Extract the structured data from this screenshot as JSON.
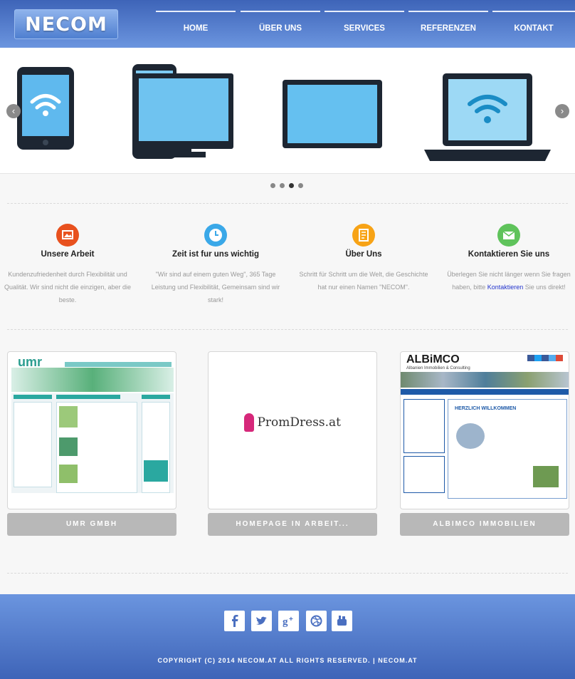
{
  "brand": {
    "logo_text": "NECOM"
  },
  "nav": [
    "HOME",
    "ÜBER UNS",
    "SERVICES",
    "REFERENZEN",
    "KONTAKT"
  ],
  "slider": {
    "prev_label": "‹",
    "next_label": "›",
    "dots": 4,
    "active_dot": 3,
    "icons": [
      "tablet-icon",
      "monitor-icon",
      "display-icon",
      "laptop-icon"
    ]
  },
  "features": [
    {
      "title": "Unsere Arbeit",
      "text": "Kundenzufriedenheit durch Flexibilität und Qualität. Wir sind nicht die einzigen, aber die beste.",
      "color": "#e8511e",
      "icon": "picture-icon"
    },
    {
      "title": "Zeit ist fur uns wichtig",
      "text": "\"Wir sind auf einem guten Weg\", 365 Tage Leistung und Flexibilität, Gemeinsam sind wir stark!",
      "color": "#3aa8e8",
      "icon": "clock-icon"
    },
    {
      "title": "Über Uns",
      "text": "Schritt für Schritt um die Welt, die Geschichte hat nur einen Namen \"NECOM\".",
      "color": "#f7a316",
      "icon": "document-icon"
    },
    {
      "title": "Kontaktieren Sie uns",
      "text_before": "Überlegen Sie nicht länger wenn Sie fragen haben, bitte ",
      "link": "Kontaktieren",
      "text_after": " Sie uns direkt!",
      "color": "#5fc35b",
      "icon": "mail-icon"
    }
  ],
  "references": [
    {
      "button": "UMR GMBH",
      "thumb_text": "umr"
    },
    {
      "button": "HOMEPAGE IN ARBEIT...",
      "thumb_text": "PromDress.at"
    },
    {
      "button": "ALBIMCO IMMOBILIEN",
      "thumb_title": "ALBiMCO",
      "thumb_subtitle": "Albanien Immobilien & Consulting",
      "thumb_heading": "HERZLICH WILLKOMMEN"
    }
  ],
  "social": [
    "facebook-icon",
    "twitter-icon",
    "google-plus-icon",
    "dribbble-icon",
    "youtube-icon"
  ],
  "footer": {
    "copyright": "COPYRIGHT (C) 2014 NECOM.AT ALL RIGHTS RESERVED. | NECOM.AT"
  },
  "colors": {
    "header_top": "#3e64b8",
    "header_bottom": "#6b95df",
    "button_gray": "#b8b8b8"
  }
}
